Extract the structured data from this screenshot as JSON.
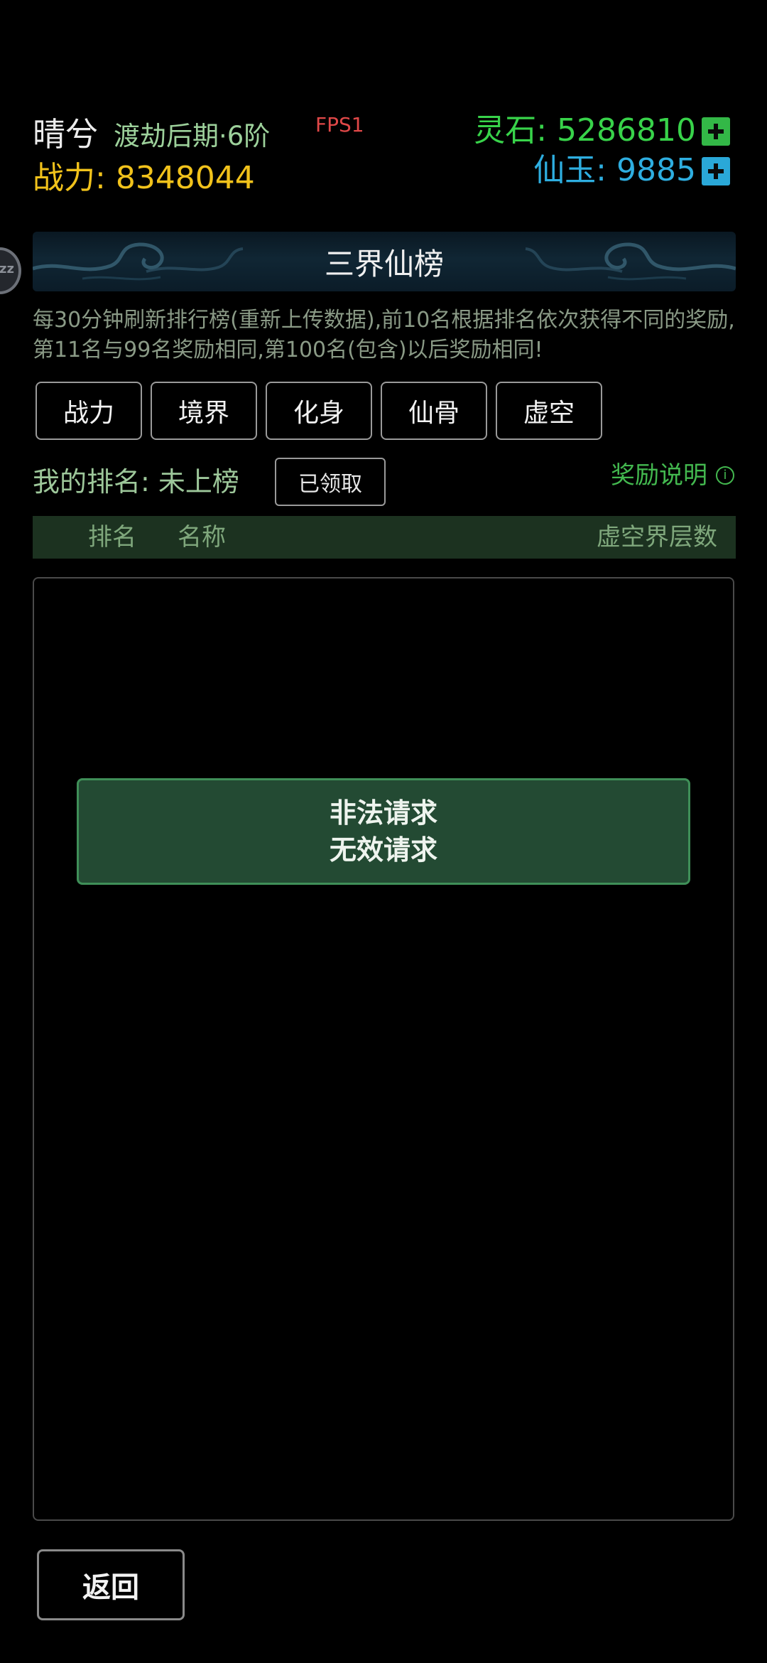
{
  "header": {
    "player_name": "晴兮",
    "realm": "渡劫后期·6阶",
    "fps": "FPS1",
    "power_label": "战力:",
    "power_value": "8348044",
    "stone_label": "灵石:",
    "stone_value": "5286810",
    "jade_label": "仙玉:",
    "jade_value": "9885",
    "plus_glyph": "+"
  },
  "side_float": {
    "label": "zz"
  },
  "banner": {
    "title": "三界仙榜"
  },
  "description": "每30分钟刷新排行榜(重新上传数据),前10名根据排名依次获得不同的奖励,第11名与99名奖励相同,第100名(包含)以后奖励相同!",
  "tabs": [
    {
      "label": "战力"
    },
    {
      "label": "境界"
    },
    {
      "label": "化身"
    },
    {
      "label": "仙骨"
    },
    {
      "label": "虚空"
    }
  ],
  "my_rank": {
    "label": "我的排名:",
    "value": "未上榜",
    "claim_button": "已领取"
  },
  "reward_info": {
    "label": "奖励说明",
    "icon_glyph": "i"
  },
  "table": {
    "headers": {
      "rank": "排名",
      "name": "名称",
      "layers": "虚空界层数"
    },
    "rows": []
  },
  "toast": {
    "line1": "非法请求",
    "line2": "无效请求"
  },
  "footer": {
    "back_button": "返回"
  },
  "colors": {
    "stone": "#38d34a",
    "jade": "#2eaee0",
    "power": "#f1c21b",
    "fps": "#e04848",
    "accent_green": "#43b84f",
    "toast_bg": "#234a33"
  }
}
